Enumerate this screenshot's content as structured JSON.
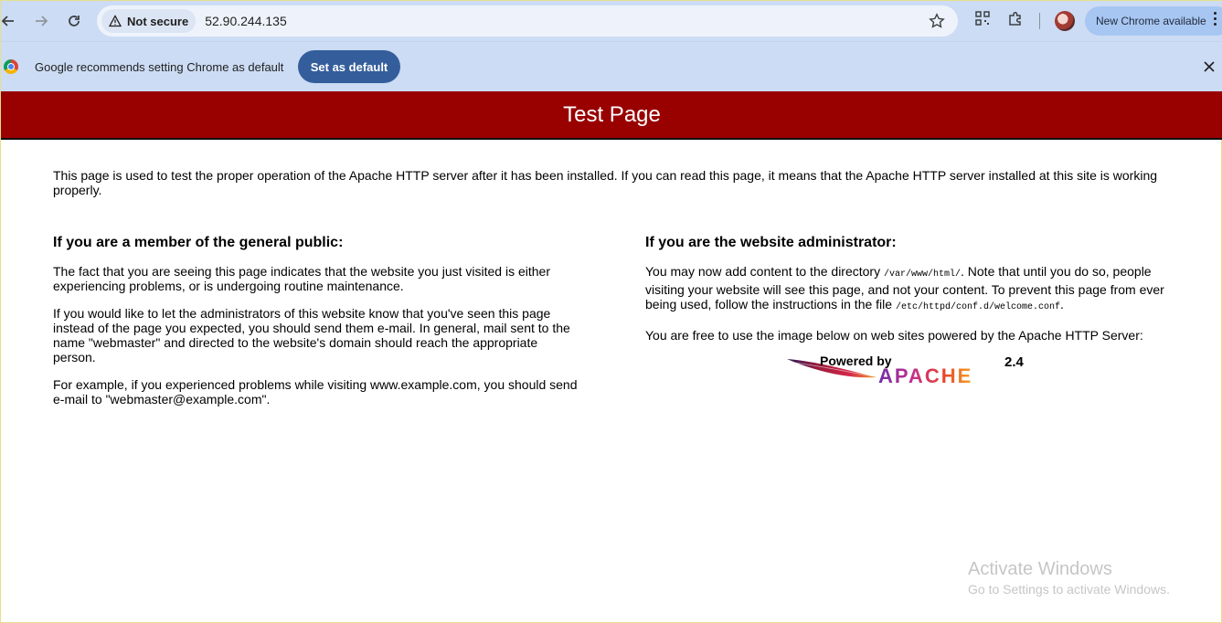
{
  "browser": {
    "security_label": "Not secure",
    "url": "52.90.244.135",
    "update_label": "New Chrome available"
  },
  "infobar": {
    "message": "Google recommends setting Chrome as default",
    "action_label": "Set as default"
  },
  "page": {
    "title": "Test Page",
    "intro": "This page is used to test the proper operation of the Apache HTTP server after it has been installed. If you can read this page, it means that the Apache HTTP server installed at this site is working properly.",
    "public": {
      "heading": "If you are a member of the general public:",
      "p1": "The fact that you are seeing this page indicates that the website you just visited is either experiencing problems, or is undergoing routine maintenance.",
      "p2": "If you would like to let the administrators of this website know that you've seen this page instead of the page you expected, you should send them e-mail. In general, mail sent to the name \"webmaster\" and directed to the website's domain should reach the appropriate person.",
      "p3": "For example, if you experienced problems while visiting www.example.com, you should send e-mail to \"webmaster@example.com\"."
    },
    "admin": {
      "heading": "If you are the website administrator:",
      "p1_a": "You may now add content to the directory ",
      "p1_dir": "/var/www/html/",
      "p1_b": ". Note that until you do so, people visiting your website will see this page, and not your content. To prevent this page from ever being used, follow the instructions in the file ",
      "p1_file": "/etc/httpd/conf.d/welcome.conf",
      "p1_c": ".",
      "p2": "You are free to use the image below on web sites powered by the Apache HTTP Server:"
    },
    "badge": {
      "powered_by": "Powered by",
      "name": "APACHE",
      "version": "2.4"
    }
  },
  "watermark": {
    "line1": "Activate Windows",
    "line2": "Go to Settings to activate Windows."
  },
  "icons": [
    "back-arrow-icon",
    "forward-arrow-icon",
    "reload-icon",
    "warning-triangle-icon",
    "star-icon",
    "qr-code-icon",
    "extensions-puzzle-icon",
    "chrome-logo-icon",
    "close-icon",
    "kebab-menu-icon"
  ]
}
